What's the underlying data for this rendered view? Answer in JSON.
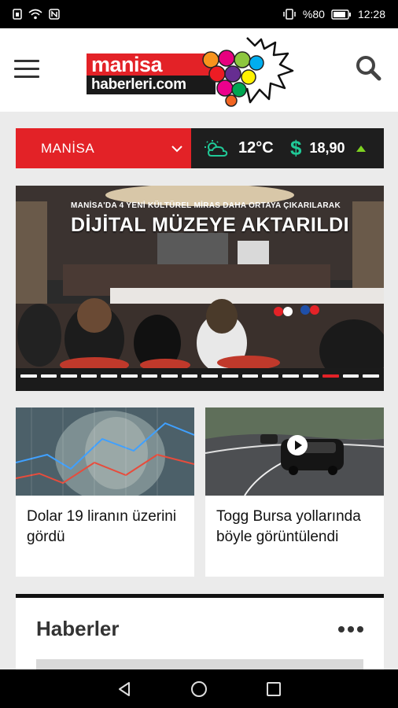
{
  "status_bar": {
    "battery": "%80",
    "time": "12:28"
  },
  "header": {
    "logo_top": "manisa",
    "logo_bottom": "haberleri.com"
  },
  "info_bar": {
    "city": "MANİSA",
    "temperature": "12°C",
    "currency_symbol": "$",
    "currency_rate": "18,90",
    "colors": {
      "accent": "#e32227",
      "dark": "#1e1e1e",
      "currency": "#20c997",
      "trend_up": "#7ed321"
    }
  },
  "hero": {
    "kicker": "MANİSA'DA 4 YENİ KÜLTÜREL MİRAS DAHA ORTAYA ÇIKARILARAK",
    "headline": "DİJİTAL MÜZEYE AKTARILDI",
    "slide_count": 18,
    "active_slide": 15
  },
  "cards": [
    {
      "title": "Dolar 19 liranın üzerini gördü",
      "has_video": false
    },
    {
      "title": "Togg Bursa yollarında böyle görüntülendi",
      "has_video": true
    }
  ],
  "haberler": {
    "title": "Haberler"
  },
  "icons": {
    "menu": "hamburger-icon",
    "search": "search-icon",
    "weather": "partly-cloudy-icon",
    "more": "more-horizontal-icon",
    "nav": [
      "back-icon",
      "home-icon",
      "recents-icon"
    ]
  }
}
